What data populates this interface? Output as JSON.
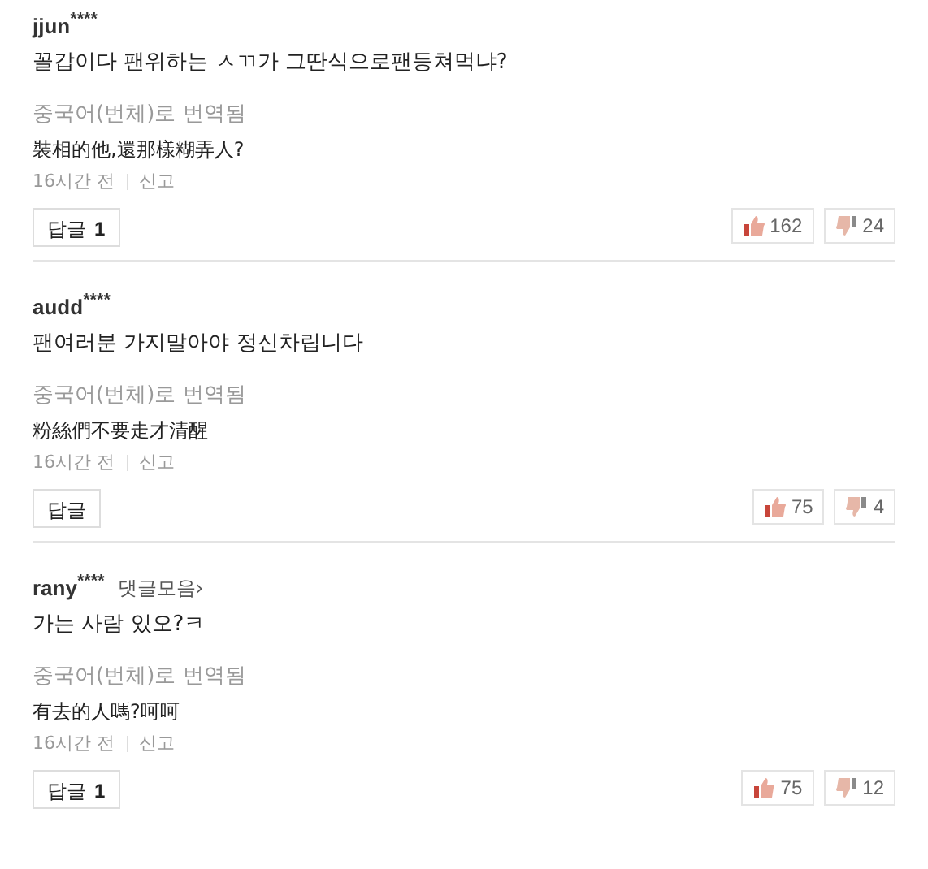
{
  "comments": [
    {
      "author": "jjun$^{****}$",
      "text": "꼴갑이다 팬위하는 ㅅㄲ가 그딴식으로팬등쳐먹냐?",
      "translation_label": "중국어(번체)로 번역됨",
      "translation": "裝相的他,還那樣糊弄人?",
      "time": "16시간 전",
      "report": "신고",
      "reply": {
        "label": "답글",
        "count": "1"
      },
      "likes": "162",
      "dislikes": "24"
    },
    {
      "author": "audd$^{****}$",
      "text": "팬여러분 가지말아야 정신차립니다",
      "translation_label": "중국어(번체)로 번역됨",
      "translation": "粉絲們不要走才清醒",
      "time": "16시간 전",
      "report": "신고",
      "reply": {
        "label": "답글"
      },
      "likes": "75",
      "dislikes": "4"
    },
    {
      "author": "rany$^{****}$",
      "collect_link": "댓글모음›",
      "text": "가는 사람 있오?ㅋ",
      "translation_label": "중국어(번체)로 번역됨",
      "translation": "有去的人嗎?呵呵",
      "time": "16시간 전",
      "report": "신고",
      "reply": {
        "label": "답글",
        "count": "1"
      },
      "likes": "75",
      "dislikes": "12"
    }
  ]
}
